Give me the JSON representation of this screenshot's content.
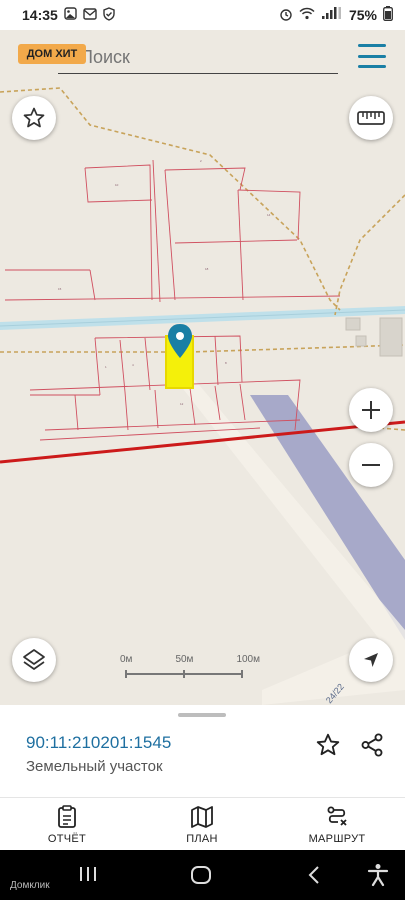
{
  "status_bar": {
    "time": "14:35",
    "battery": "75%",
    "icons": [
      "gallery-icon",
      "mail-icon",
      "shield-check-icon",
      "alarm-icon",
      "wifi-icon",
      "signal-icon",
      "battery-icon"
    ]
  },
  "search": {
    "placeholder": "Поиск",
    "logo_text": "ДОМ ХИТ"
  },
  "map": {
    "road_label": "24/22",
    "scale_labels": [
      "0м",
      "50м",
      "100м"
    ],
    "colors": {
      "background": "#ede9e1",
      "parcel_lines": "#d05060",
      "highlight_fill": "#f4f00a",
      "highlight_border": "#e8d800",
      "marker": "#1a7fa5",
      "red_line": "#cc1a1a",
      "highway": "#a7a9c9",
      "water": "#bfe0ea",
      "path": "#c8a35a"
    }
  },
  "buttons": {
    "favorite": "star-icon",
    "ruler": "ruler-icon",
    "zoom_in": "plus-icon",
    "zoom_out": "minus-icon",
    "layers": "layers-icon",
    "locate": "navigation-arrow-icon"
  },
  "panel": {
    "cadastral_number": "90:11:210201:1545",
    "plot_type": "Земельный участок"
  },
  "tabs": [
    {
      "label": "ОТЧЁТ",
      "icon": "report-icon"
    },
    {
      "label": "ПЛАН",
      "icon": "map-plan-icon"
    },
    {
      "label": "МАРШРУТ",
      "icon": "route-icon"
    }
  ],
  "nav": {
    "watermark": "Домклик"
  }
}
